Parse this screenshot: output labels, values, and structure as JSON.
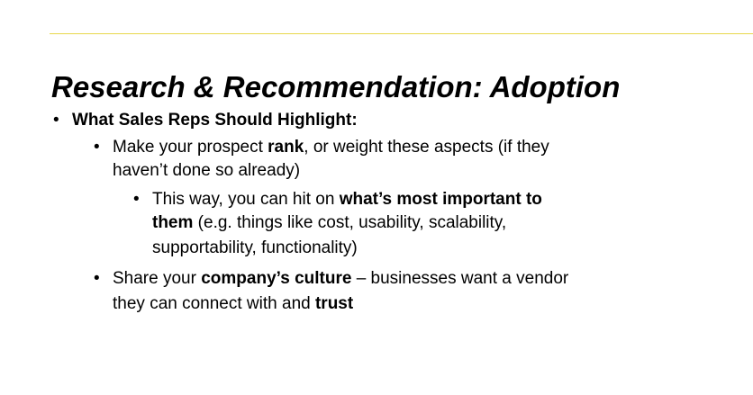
{
  "slide": {
    "accent_color": "#e8d84a",
    "title": "Research & Recommendation: Adoption",
    "bullets": {
      "l1": {
        "marker": "•",
        "text": "What Sales Reps Should Highlight:"
      },
      "l2a": {
        "marker": "•",
        "pre": "Make your prospect ",
        "bold": "rank",
        "post": ", or weight these aspects (if they",
        "cont": "haven’t done so already)"
      },
      "l3": {
        "marker": "•",
        "pre": "This way, you can hit on ",
        "bold1": "what’s most important to",
        "bold2": "them",
        "post2": " (e.g. things like cost, usability, scalability,",
        "cont": "supportability, functionality)"
      },
      "l2b": {
        "marker": "•",
        "pre": "Share your ",
        "bold": "company’s culture",
        "post": " – businesses want a vendor",
        "cont_pre": "they can connect with and ",
        "cont_bold": "trust"
      }
    }
  }
}
